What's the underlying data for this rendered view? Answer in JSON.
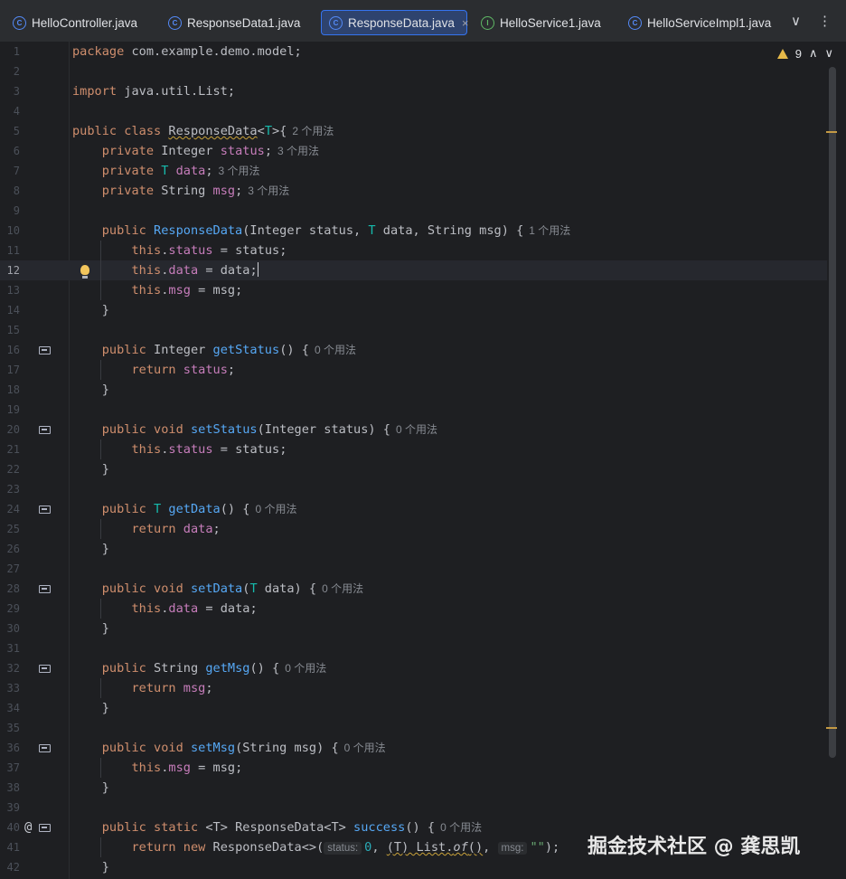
{
  "tabs": [
    {
      "label": "HelloController.java",
      "icon_letter": "C",
      "kind": "class"
    },
    {
      "label": "ResponseData1.java",
      "icon_letter": "C",
      "kind": "class"
    },
    {
      "label": "ResponseData.java",
      "icon_letter": "C",
      "kind": "class",
      "active": true
    },
    {
      "label": "HelloService1.java",
      "icon_letter": "I",
      "kind": "interface"
    },
    {
      "label": "HelloServiceImpl1.java",
      "icon_letter": "C",
      "kind": "class"
    }
  ],
  "tab_close": "×",
  "tab_more": "∨",
  "tab_menu": "⋮",
  "inspection": {
    "count": "9",
    "up": "∧",
    "down": "∨"
  },
  "line_numbers": [
    "1",
    "2",
    "3",
    "4",
    "5",
    "6",
    "7",
    "8",
    "9",
    "10",
    "11",
    "12",
    "13",
    "14",
    "15",
    "16",
    "17",
    "18",
    "19",
    "20",
    "21",
    "22",
    "23",
    "24",
    "25",
    "26",
    "27",
    "28",
    "29",
    "30",
    "31",
    "32",
    "33",
    "34",
    "35",
    "36",
    "37",
    "38",
    "39",
    "40",
    "41",
    "42"
  ],
  "current_line": "12",
  "code": {
    "l1_package": "package",
    "l1_name": " com.example.demo.model;",
    "l3_import": "import",
    "l3_name": " java.util.List;",
    "l5_public": "public class ",
    "l5_class": "ResponseData",
    "l5_gen_open": "<",
    "l5_T": "T",
    "l5_gen_close": ">{",
    "l5_hint": "2 个用法",
    "l6_private": "    private ",
    "l6_type": "Integer ",
    "l6_field": "status",
    "l6_semi": ";",
    "l6_hint": "3 个用法",
    "l7_private": "    private ",
    "l7_type": "T ",
    "l7_field": "data",
    "l7_semi": ";",
    "l7_hint": "3 个用法",
    "l8_private": "    private ",
    "l8_type": "String ",
    "l8_field": "msg",
    "l8_semi": ";",
    "l8_hint": "3 个用法",
    "l10_public": "    public ",
    "l10_ctor": "ResponseData",
    "l10_p1": "(Integer status, ",
    "l10_T": "T",
    "l10_p2": " data, String msg) {",
    "l10_hint": "1 个用法",
    "this": "this",
    "l11_field": "status",
    "l11_rest": " = status;",
    "l12_field": "data",
    "l12_rest": " = data;",
    "l13_field": "msg",
    "l13_rest": " = msg;",
    "close_brace_4": "    }",
    "close_brace_0": "}",
    "l16_public": "    public ",
    "l16_type": "Integer ",
    "l16_method": "getStatus",
    "l16_rest": "() {",
    "hint_0": "0 个用法",
    "return": "return ",
    "l17_field": "status",
    "semi": ";",
    "l20_public": "    public void ",
    "l20_method": "setStatus",
    "l20_rest": "(Integer status) {",
    "l21_field": "status",
    "l21_rest": " = status;",
    "l24_public": "    public ",
    "l24_T": "T ",
    "l24_method": "getData",
    "l24_rest": "() {",
    "l25_field": "data",
    "l28_public": "    public void ",
    "l28_method": "setData",
    "l28_p1": "(",
    "l28_T": "T",
    "l28_p2": " data) {",
    "l29_field": "data",
    "l29_rest": " = data;",
    "l32_public": "    public ",
    "l32_type": "String ",
    "l32_method": "getMsg",
    "l32_rest": "() {",
    "l33_field": "msg",
    "l36_public": "    public void ",
    "l36_method": "setMsg",
    "l36_rest": "(String msg) {",
    "l37_field": "msg",
    "l37_rest": " = msg;",
    "l40_public": "    public static ",
    "l40_gen": "<T>",
    "l40_type": " ResponseData",
    "l40_gen2": "<T>",
    "l40_method": " success",
    "l40_rest": "() {",
    "l41_return": "return new ",
    "l41_type": "ResponseData<>(",
    "l41_hint_status": "status:",
    "l41_zero": "0",
    "l41_comma": ", ",
    "l41_cast": "(T) List.",
    "l41_of": "of",
    "l41_paren": "()",
    "l41_comma2": ", ",
    "l41_hint_msg": "msg:",
    "l41_str": "\"\"",
    "l41_end": ");",
    "at": "@"
  },
  "watermark": "掘金技术社区 @ 龚思凯",
  "colors": {
    "keyword": "#cf8e6d",
    "field": "#c77dbb",
    "method": "#56a8f5",
    "type_param": "#16baac",
    "string": "#6aab73",
    "number": "#2aacb8"
  }
}
